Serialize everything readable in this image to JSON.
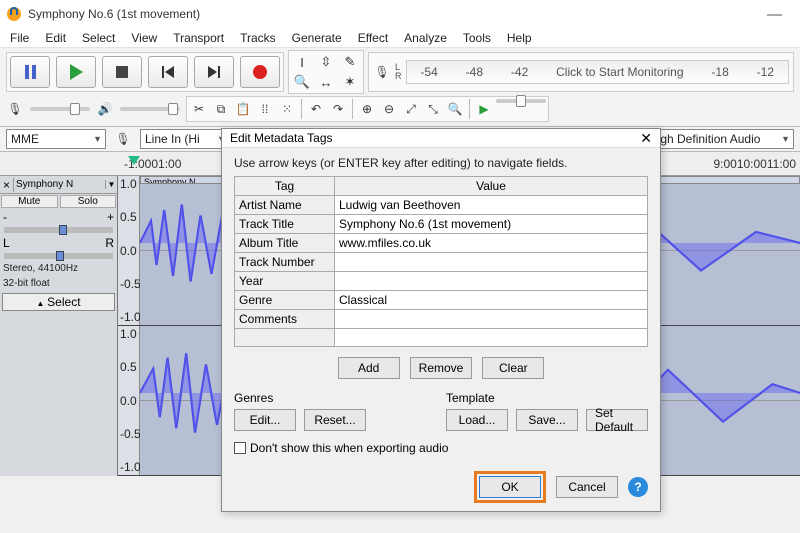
{
  "window": {
    "title": "Symphony No.6 (1st movement)"
  },
  "menu": [
    "File",
    "Edit",
    "Select",
    "View",
    "Transport",
    "Tracks",
    "Generate",
    "Effect",
    "Analyze",
    "Tools",
    "Help"
  ],
  "meter": {
    "ticks": [
      "-54",
      "-48",
      "-42"
    ],
    "click_label": "Click to Start Monitoring",
    "ticks2": [
      "-18",
      "-12"
    ]
  },
  "device": {
    "host": "MME",
    "input": "Line In (Hi",
    "output": "High Definition Audio"
  },
  "ruler": [
    "-1:00",
    "0",
    "1:00",
    "9:00",
    "10:00",
    "11:00"
  ],
  "track": {
    "name": "Symphony N",
    "mute": "Mute",
    "solo": "Solo",
    "gain_plus": "+",
    "gain_minus": "-",
    "pan_l": "L",
    "pan_r": "R",
    "info1": "Stereo, 44100Hz",
    "info2": "32-bit float",
    "select": "Select",
    "amp": [
      "1.0",
      "0.5",
      "0.0",
      "-0.5",
      "-1.0"
    ]
  },
  "dialog": {
    "title": "Edit Metadata Tags",
    "instruction": "Use arrow keys (or ENTER key after editing) to navigate fields.",
    "cols": [
      "Tag",
      "Value"
    ],
    "rows": [
      {
        "tag": "Artist Name",
        "value": "Ludwig van Beethoven"
      },
      {
        "tag": "Track Title",
        "value": "Symphony No.6 (1st movement)"
      },
      {
        "tag": "Album Title",
        "value": "www.mfiles.co.uk"
      },
      {
        "tag": "Track Number",
        "value": ""
      },
      {
        "tag": "Year",
        "value": ""
      },
      {
        "tag": "Genre",
        "value": "Classical"
      },
      {
        "tag": "Comments",
        "value": ""
      },
      {
        "tag": "",
        "value": ""
      }
    ],
    "buttons": {
      "add": "Add",
      "remove": "Remove",
      "clear": "Clear"
    },
    "genres": {
      "label": "Genres",
      "edit": "Edit...",
      "reset": "Reset..."
    },
    "template": {
      "label": "Template",
      "load": "Load...",
      "save": "Save...",
      "setdef": "Set Default"
    },
    "dont_show": "Don't show this when exporting audio",
    "ok": "OK",
    "cancel": "Cancel",
    "help": "?"
  }
}
